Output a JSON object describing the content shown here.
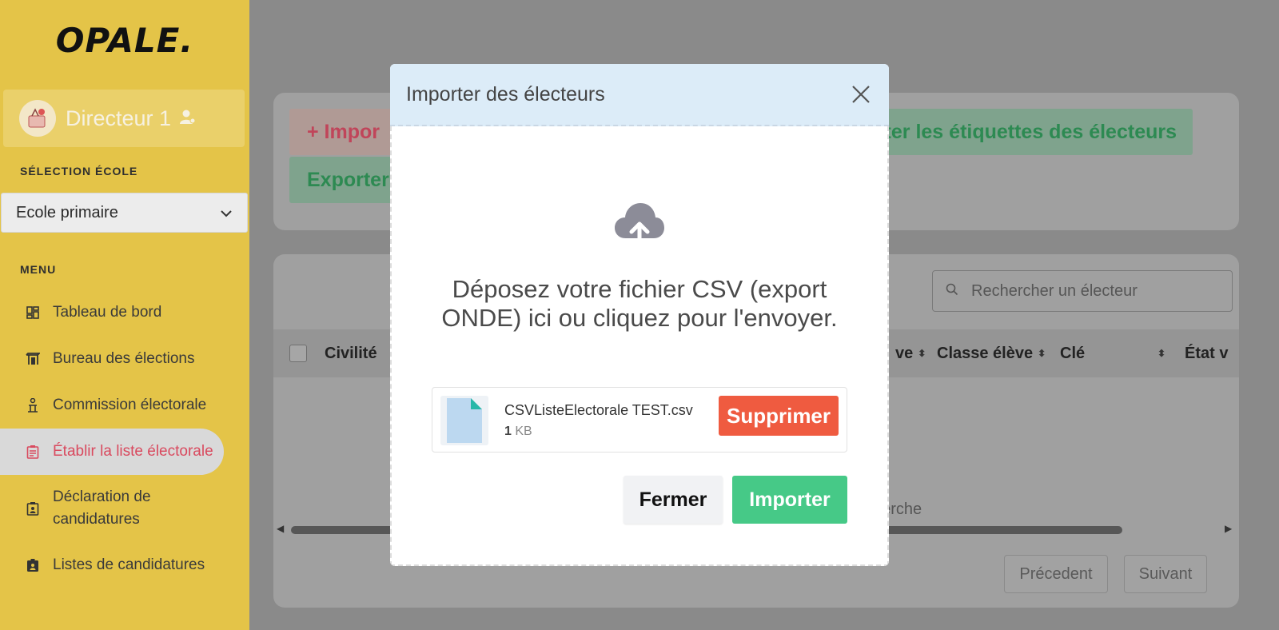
{
  "app": {
    "logo": "OPALE."
  },
  "user": {
    "name": "Directeur 1"
  },
  "sidebar": {
    "school_section_label": "SÉLECTION ÉCOLE",
    "school_selected": "Ecole primaire",
    "menu_label": "MENU",
    "items": [
      {
        "label": "Tableau de bord",
        "icon": "dashboard-icon"
      },
      {
        "label": "Bureau des élections",
        "icon": "booth-icon"
      },
      {
        "label": "Commission électorale",
        "icon": "person-podium-icon"
      },
      {
        "label": "Établir la liste électorale",
        "icon": "clipboard-list-icon",
        "active": true
      },
      {
        "label": "Déclaration de candidatures",
        "icon": "clipboard-user-icon"
      },
      {
        "label": "Listes de candidatures",
        "icon": "badge-icon"
      }
    ]
  },
  "background": {
    "import_button": "+  Impor",
    "export_button": "Exporter",
    "labels_button": "rter les étiquettes des électeurs",
    "search_placeholder": "Rechercher un électeur",
    "columns": [
      "Civilité",
      "ve",
      "Classe élève",
      "Clé",
      "État v"
    ],
    "empty_text": "herche",
    "prev_button": "Précedent",
    "next_button": "Suivant"
  },
  "modal": {
    "title": "Importer des électeurs",
    "drop_text": "Déposez votre fichier CSV (export ONDE) ici ou cliquez pour l'envoyer.",
    "file": {
      "name": "CSVListeElectorale TEST.csv",
      "size_value": "1",
      "size_unit": "KB"
    },
    "delete_button": "Supprimer",
    "close_button": "Fermer",
    "import_button": "Importer"
  },
  "colors": {
    "accent_red": "#ef5b40",
    "accent_green": "#46c987",
    "sidebar_bg": "#e4c448",
    "active_nav": "#d94a5f"
  }
}
